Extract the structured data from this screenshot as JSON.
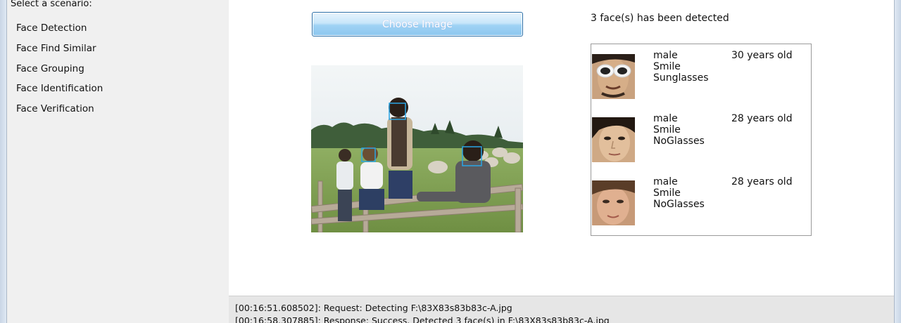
{
  "sidebar": {
    "title": "Select a scenario:",
    "items": [
      {
        "label": "Face Detection"
      },
      {
        "label": "Face Find Similar"
      },
      {
        "label": "Face Grouping"
      },
      {
        "label": "Face Identification"
      },
      {
        "label": "Face Verification"
      }
    ]
  },
  "main": {
    "choose_button_label": "Choose Image",
    "detect_status": "3 face(s) has been detected",
    "faces": [
      {
        "gender": "male",
        "expression": "Smile",
        "glasses": "Sunglasses",
        "age": "30 years old"
      },
      {
        "gender": "male",
        "expression": "Smile",
        "glasses": "NoGlasses",
        "age": "28 years old"
      },
      {
        "gender": "male",
        "expression": "Smile",
        "glasses": "NoGlasses",
        "age": "28 years old"
      }
    ]
  },
  "log": {
    "lines": [
      "[00:16:51.608502]: Request: Detecting F:\\83X83s83b83c-A.jpg",
      "[00:16:58.307885]: Response: Success. Detected 3 face(s) in F:\\83X83s83b83c-A.jpg"
    ]
  },
  "colors": {
    "button_border": "#2a6fa8",
    "face_box": "#2aa6e6",
    "sidebar_bg": "#f0f0f0",
    "log_bg": "#e6e6e6"
  }
}
